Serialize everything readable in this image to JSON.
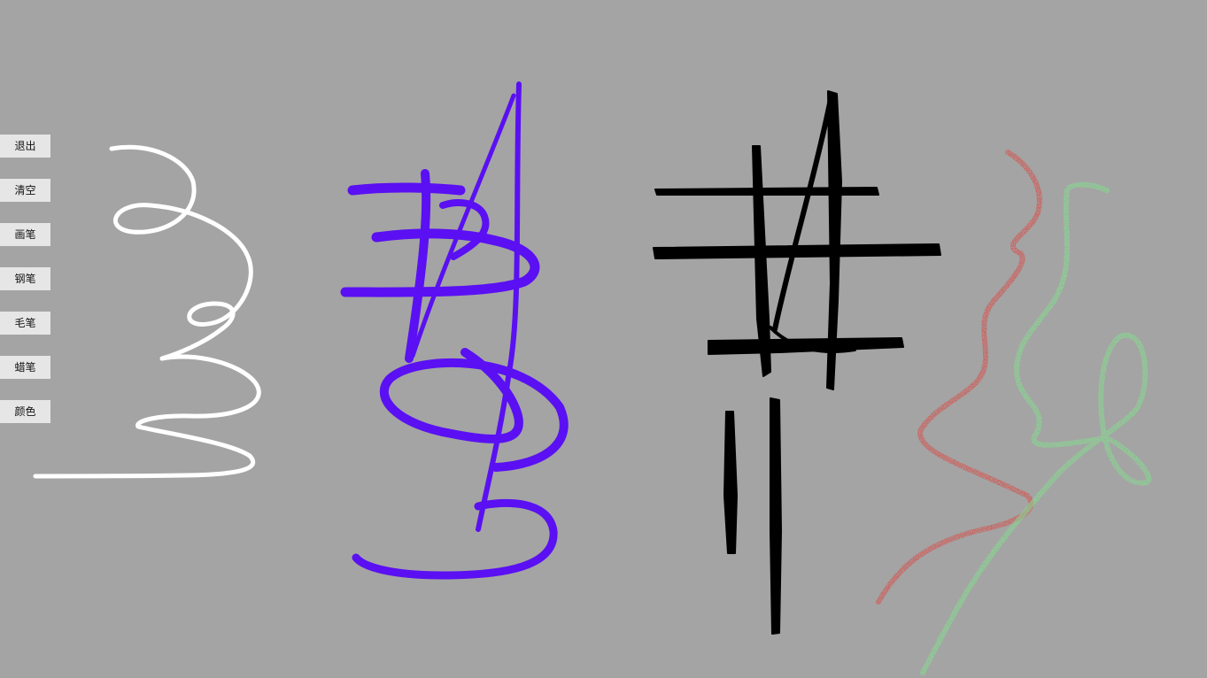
{
  "toolbar": {
    "exit_label": "退出",
    "clear_label": "清空",
    "brush_label": "画笔",
    "pen_label": "钢笔",
    "calligraphy_label": "毛笔",
    "crayon_label": "蜡笔",
    "color_label": "颜色"
  },
  "canvas": {
    "background_color": "#a4a4a4",
    "strokes": [
      {
        "tool": "brush",
        "color": "#ffffff"
      },
      {
        "tool": "pen",
        "color": "#5a10f2"
      },
      {
        "tool": "calligraphy",
        "color": "#000000"
      },
      {
        "tool": "crayon",
        "color": "#e0403a"
      },
      {
        "tool": "crayon",
        "color": "#7ee88a"
      }
    ]
  }
}
